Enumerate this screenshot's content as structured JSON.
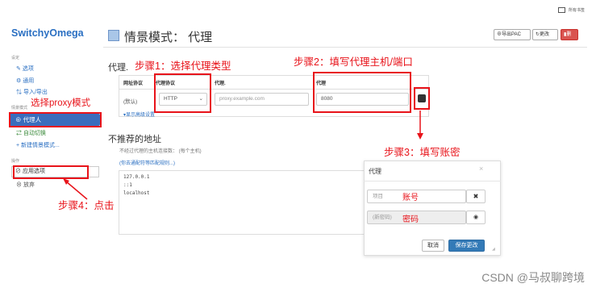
{
  "topbar": {
    "folder_label": "所有书签"
  },
  "sidebar": {
    "brand": "SwitchyOmega",
    "settings_header": "设定",
    "items_top": [
      {
        "icon": "wrench-icon",
        "label": "选项"
      },
      {
        "icon": "gear-icon",
        "label": "通用"
      },
      {
        "icon": "import-export-icon",
        "label": "导入/导出"
      }
    ],
    "profiles_header": "情景模式",
    "active_profile": "代理人",
    "auto_switch": "自动切换",
    "new_profile": "+ 新建情景模式...",
    "actions_header": "操作",
    "apply_options": "应用选项",
    "discard": "放弃"
  },
  "header": {
    "title": "情景模式：  代理",
    "export_pac": "导出PAC",
    "rename": "更改",
    "delete": "删"
  },
  "proxy": {
    "section_title": "代理.",
    "columns": [
      "网址协议",
      "代理协议",
      "代理.",
      "代理"
    ],
    "row_scheme": "(默认)",
    "protocol": "HTTP",
    "server_placeholder": "proxy.example.com",
    "port": "8080",
    "show_advanced": "显示高级设置"
  },
  "bypass": {
    "title": "不推荐的地址",
    "hint": "不经过代理的主机连接数：  (每个主机)",
    "link": "(你去通配符等匹配规则...)",
    "entries": "127.0.0.1\n::1\nlocalhost"
  },
  "auth_dialog": {
    "title": "代理",
    "username_placeholder": "项目",
    "password_placeholder": "(新密码)",
    "username_annotation": "账号",
    "password_annotation": "密码",
    "cancel": "取消",
    "save": "保存更改"
  },
  "annotations": {
    "step1": "步骤1：选择代理类型",
    "step2": "步骤2：填写代理主机/端口",
    "step3": "步骤3：填写账密",
    "step4": "步骤4：点击",
    "select_proxy": "选择proxy模式"
  },
  "watermark": "CSDN @马叔聊跨境",
  "colors": {
    "annotation_red": "#e8131a",
    "accent_blue": "#3a6dbd",
    "primary_button": "#337ab7"
  }
}
